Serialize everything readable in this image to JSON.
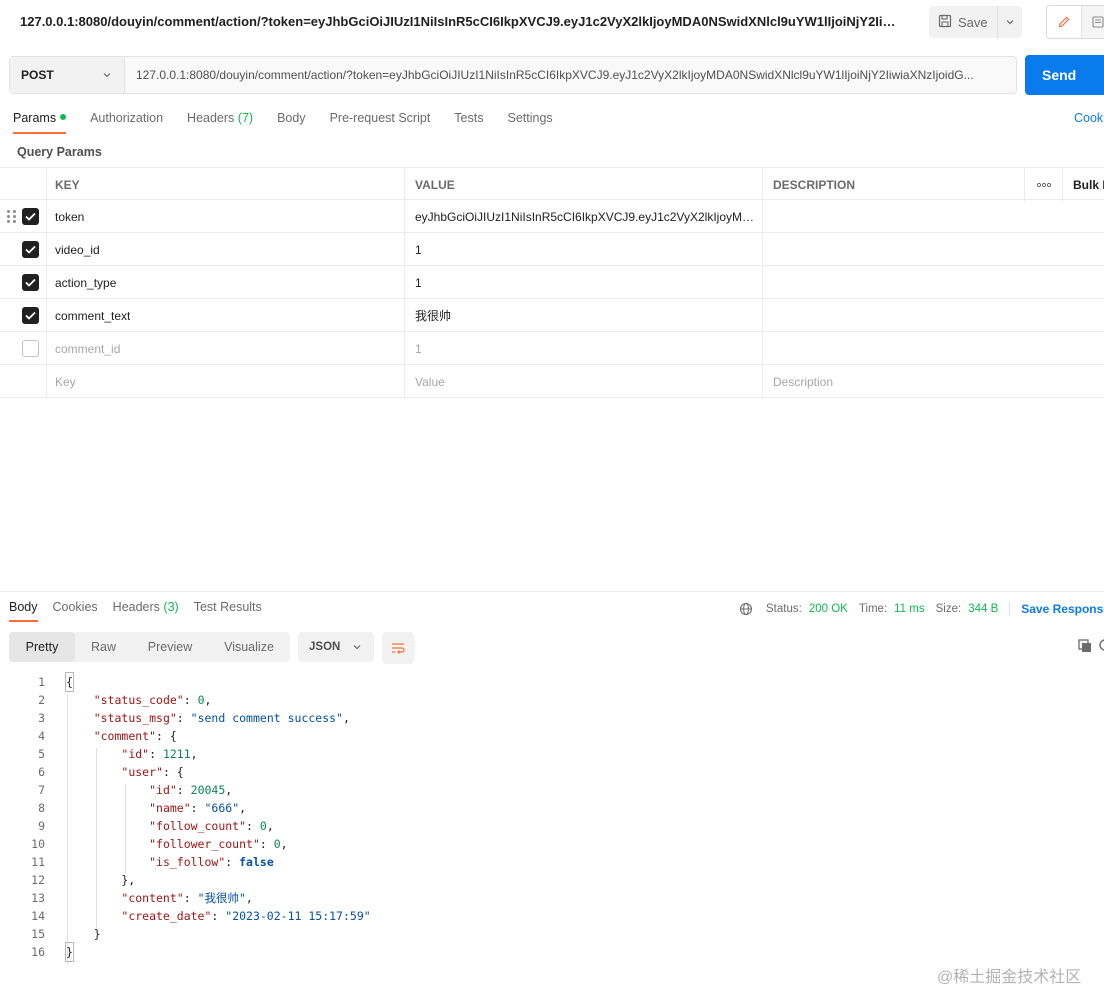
{
  "request": {
    "title": "127.0.0.1:8080/douyin/comment/action/?token=eyJhbGciOiJIUzI1NiIsInR5cCI6IkpXVCJ9.eyJ1c2VyX2lkIjoyMDA0NSwidXNlcl9uYW1lIjoiNjY2IiwiaXNzIjj...",
    "save_label": "Save",
    "method": "POST",
    "url": "127.0.0.1:8080/douyin/comment/action/?token=eyJhbGciOiJIUzI1NiIsInR5cCI6IkpXVCJ9.eyJ1c2VyX2lkIjoyMDA0NSwidXNlcl9uYW1lIjoiNjY2IiwiaXNzIjoidG...",
    "send_label": "Send"
  },
  "req_tabs": {
    "params": "Params",
    "authorization": "Authorization",
    "headers": "Headers",
    "headers_count": "(7)",
    "body": "Body",
    "prerequest": "Pre-request Script",
    "tests": "Tests",
    "settings": "Settings",
    "cookies": "Cook"
  },
  "query_params": {
    "title": "Query Params",
    "headers": {
      "key": "KEY",
      "value": "VALUE",
      "description": "DESCRIPTION",
      "bulk": "Bulk E"
    },
    "rows": [
      {
        "key": "token",
        "value": "eyJhbGciOiJIUzI1NiIsInR5cCI6IkpXVCJ9.eyJ1c2VyX2lkIjoyMDA0NSwidXNlcl9uYW1lIjoiNjY2IiwiaXNzIjoidG...",
        "checked": true
      },
      {
        "key": "video_id",
        "value": "1",
        "checked": true
      },
      {
        "key": "action_type",
        "value": "1",
        "checked": true
      },
      {
        "key": "comment_text",
        "value": "我很帅",
        "checked": true
      },
      {
        "key": "comment_id",
        "value": "1",
        "checked": false
      }
    ],
    "placeholders": {
      "key": "Key",
      "value": "Value",
      "description": "Description"
    }
  },
  "response": {
    "tabs": {
      "body": "Body",
      "cookies": "Cookies",
      "headers": "Headers",
      "headers_count": "(3)",
      "test_results": "Test Results"
    },
    "status_label": "Status:",
    "status_value": "200 OK",
    "time_label": "Time:",
    "time_value": "11 ms",
    "size_label": "Size:",
    "size_value": "344 B",
    "save_response": "Save Response",
    "views": [
      "Pretty",
      "Raw",
      "Preview",
      "Visualize"
    ],
    "format": "JSON",
    "code_lines": [
      "{",
      "    \"status_code\": 0,",
      "    \"status_msg\": \"send comment success\",",
      "    \"comment\": {",
      "        \"id\": 1211,",
      "        \"user\": {",
      "            \"id\": 20045,",
      "            \"name\": \"666\",",
      "            \"follow_count\": 0,",
      "            \"follower_count\": 0,",
      "            \"is_follow\": false",
      "        },",
      "        \"content\": \"我很帅\",",
      "        \"create_date\": \"2023-02-11 15:17:59\"",
      "    }",
      "}"
    ]
  },
  "watermark": "@稀土掘金技术社区"
}
